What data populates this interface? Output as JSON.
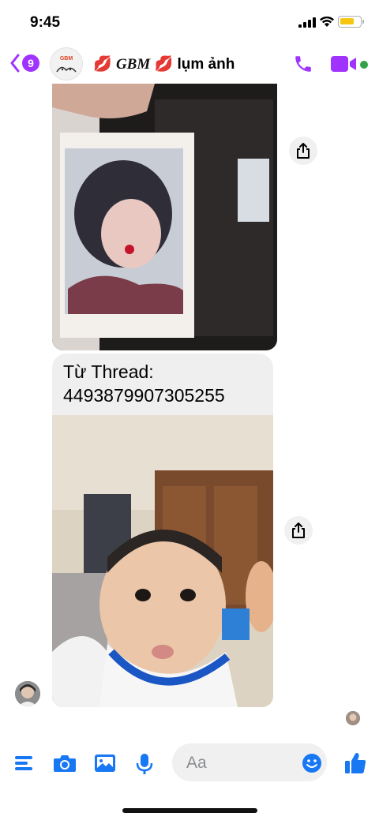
{
  "status": {
    "time": "9:45"
  },
  "header": {
    "back_count": "9",
    "avatar_text": "GBM",
    "title_emoji_left": "💋",
    "title_name": "GBM",
    "title_emoji_right": "💋",
    "title_suffix": " lụm ảnh",
    "accent": "#a033ff"
  },
  "messages": {
    "thread_label": "Từ Thread:",
    "thread_id": "4493879907305255"
  },
  "composer": {
    "placeholder": "Aa",
    "accent": "#1877f2"
  }
}
